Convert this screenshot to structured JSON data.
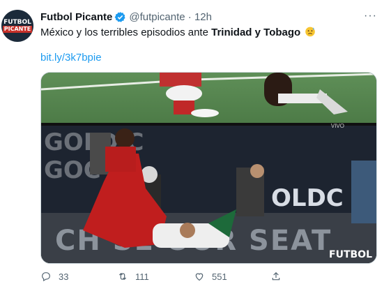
{
  "tweet": {
    "avatar_line1": "FUTBOL",
    "avatar_line2": "PICANTE",
    "display_name": "Futbol Picante",
    "handle_time": "@futpicante · 12h",
    "text_prefix": "México y los terribles episodios ante ",
    "text_bold": "Trinidad y Tobago",
    "emoji": "anxious-face-with-sweat-icon",
    "link": "bit.ly/3k7bpie",
    "more_icon": "more-icon"
  },
  "media": {
    "board_top": "GOLD C",
    "board_top_2": "GOC",
    "board_right": "OLDC",
    "adboard_text": "CH    SE   OUR SEAT",
    "watermark": "FUTBOL",
    "live_label": "VIVO"
  },
  "actions": {
    "reply_count": "33",
    "retweet_count": "111",
    "like_count": "551"
  },
  "colors": {
    "link": "#1d9bf0",
    "verified": "#1d9bf0",
    "muted": "#536471"
  }
}
